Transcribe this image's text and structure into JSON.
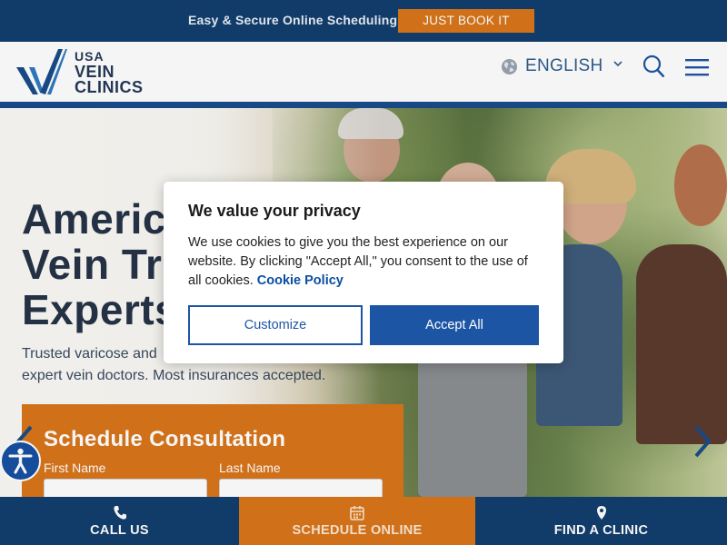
{
  "topbar": {
    "message": "Easy & Secure Online Scheduling",
    "book_button": "JUST BOOK IT"
  },
  "header": {
    "logo": {
      "line1": "USA",
      "line2": "VEIN",
      "line3": "CLINICS"
    },
    "language": "ENGLISH",
    "icons": [
      "globe-icon",
      "chevron-down-icon",
      "search-icon",
      "hamburger-menu-icon"
    ]
  },
  "hero": {
    "title_line1": "Americ",
    "title_line2": "Vein Tr",
    "title_line3": "Experts",
    "subtitle_line1": "Trusted varicose and",
    "subtitle_line2": "expert vein doctors. Most insurances accepted."
  },
  "schedule_form": {
    "title": "Schedule Consultation",
    "first_name_label": "First Name",
    "last_name_label": "Last Name",
    "first_name_value": "",
    "last_name_value": ""
  },
  "bottom_nav": {
    "call": "CALL US",
    "schedule": "SCHEDULE ONLINE",
    "find": "FIND A CLINIC"
  },
  "cookie_modal": {
    "title": "We value your privacy",
    "body": "We use cookies to give you the best experience on our website. By clicking \"Accept All,\" you consent to the use of all cookies.",
    "link": "Cookie Policy",
    "customize_button": "Customize",
    "accept_button": "Accept All"
  },
  "colors": {
    "navy": "#123e6e",
    "orange": "#d9761c",
    "accent_blue": "#1d55a5"
  }
}
